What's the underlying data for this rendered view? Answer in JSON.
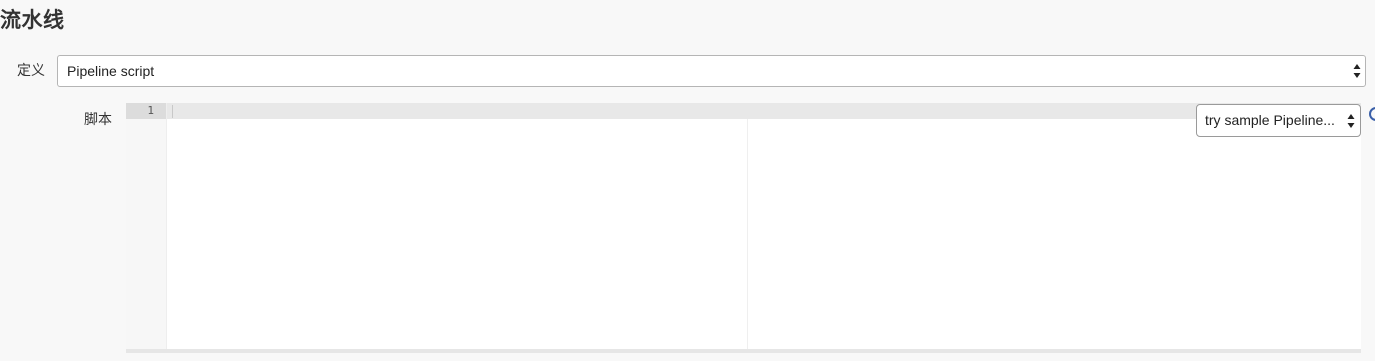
{
  "section": {
    "title": "流水线"
  },
  "definition": {
    "label": "定义",
    "selected": "Pipeline script"
  },
  "script": {
    "label": "脚本",
    "line_numbers": [
      "1"
    ],
    "sample_select": "try sample Pipeline..."
  },
  "icons": {
    "select_arrows": "up-down-arrows-icon",
    "help": "help-icon"
  },
  "colors": {
    "background": "#f8f8f8",
    "help_icon": "#3a5fa8"
  }
}
